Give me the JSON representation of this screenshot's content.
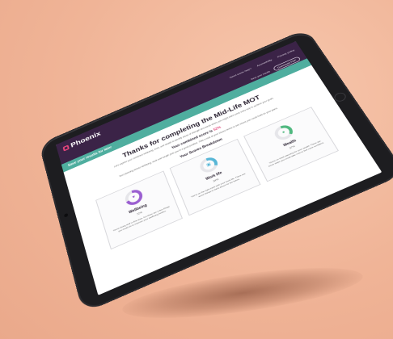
{
  "header": {
    "brand": "Phoenix",
    "nav": [
      "Need some help?",
      "Accessibility",
      "Privacy policy"
    ],
    "actions": [
      "Save your results",
      "Download PDF"
    ]
  },
  "banner": {
    "text": "Save your results for later"
  },
  "main": {
    "title": "Thanks for completing the Mid-Life MOT",
    "intro": "Let's explore your combined wellbeing, work, and wealth to identify areas of strength and areas where you might want some extra help to achieve your goals.",
    "combined_label": "Your combined score is",
    "combined_value": "52%",
    "planning_text": "Your planning across wellbeing, work and wealth puts you in a good position. Take a look at your scores below to see where you could build on your plans.",
    "breakdown_title": "Your Scores Breakdown"
  },
  "cards": [
    {
      "name": "Wellbeing",
      "percent": "72%",
      "progress": 0.72,
      "color": "#9b5fd1",
      "icon": "heart-icon",
      "text": "You're doing well in this area, but there are a few things you could do to improve your wellbeing further."
    },
    {
      "name": "Work life",
      "percent": "34%",
      "progress": 0.34,
      "color": "#57b6d6",
      "icon": "briefcase-icon",
      "text": "You're on the right track with your work life. There are some things to think about for the future."
    },
    {
      "name": "Wealth",
      "percent": "37%",
      "progress": 0.37,
      "color": "#4fb87f",
      "icon": "coin-icon",
      "text": "You're on track planning for your wealth. There are some steps you could take now to feel more confident."
    }
  ]
}
